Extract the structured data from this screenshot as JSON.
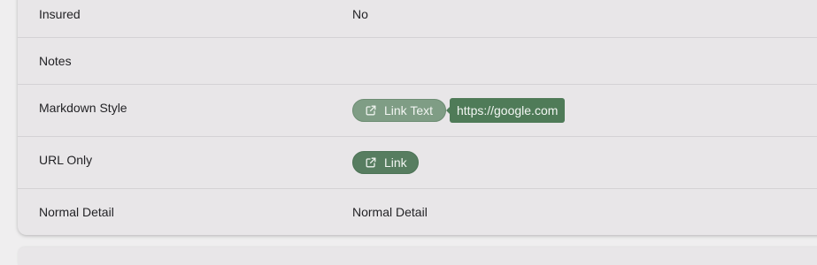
{
  "details": {
    "rows": [
      {
        "label": "Insured",
        "value": "No"
      },
      {
        "label": "Notes",
        "value": ""
      },
      {
        "label": "Markdown Style",
        "link_text": "Link Text",
        "tooltip": "https://google.com"
      },
      {
        "label": "URL Only",
        "link_text": "Link"
      },
      {
        "label": "Normal Detail",
        "value": "Normal Detail"
      }
    ]
  },
  "icons": {
    "external_link": "external-link-icon"
  },
  "colors": {
    "link_pill_hover": "#7f9d85",
    "link_pill": "#577d60",
    "tooltip_bg": "#4f7b58",
    "card_bg": "#e8e6e8",
    "page_bg": "#efeeef"
  }
}
